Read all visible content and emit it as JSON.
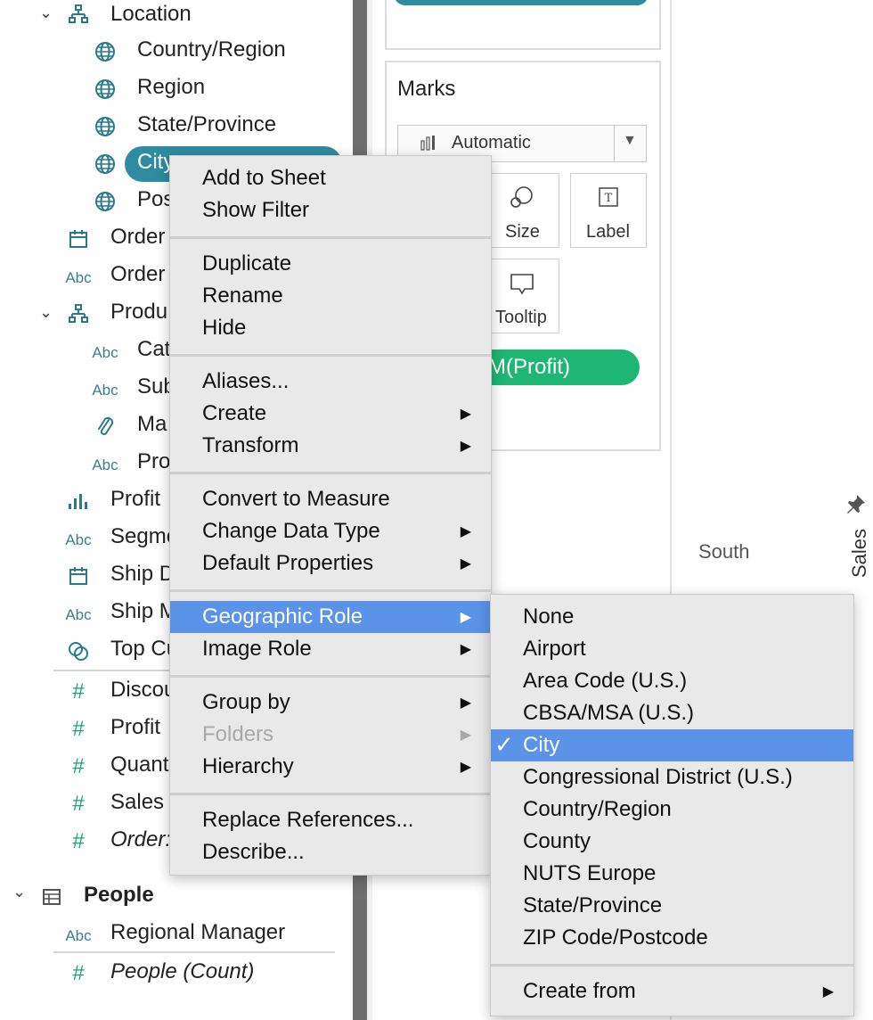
{
  "data_pane": {
    "location": {
      "label": "Location",
      "items": [
        {
          "label": "Country/Region",
          "icon": "globe-icon"
        },
        {
          "label": "Region",
          "icon": "globe-icon"
        },
        {
          "label": "State/Province",
          "icon": "globe-icon"
        },
        {
          "label": "City",
          "icon": "globe-icon"
        },
        {
          "label": "Pos",
          "icon": "globe-icon"
        }
      ]
    },
    "fields_a": [
      {
        "label": "Order",
        "icon": "calendar-icon"
      },
      {
        "label": "Order",
        "icon": "abc-icon",
        "glyph": "Abc"
      }
    ],
    "product": {
      "label": "Produ",
      "items": [
        {
          "label": "Cat",
          "glyph": "Abc"
        },
        {
          "label": "Sub",
          "glyph": "Abc"
        },
        {
          "label": "Ma",
          "glyph": "paperclip"
        },
        {
          "label": "Pro",
          "glyph": "Abc"
        }
      ]
    },
    "fields_b": [
      {
        "label": "Profit",
        "glyph": "bars"
      },
      {
        "label": "Segme",
        "glyph": "Abc"
      },
      {
        "label": "Ship D",
        "glyph": "calendar"
      },
      {
        "label": "Ship M",
        "glyph": "Abc"
      },
      {
        "label": "Top Cu",
        "glyph": "set"
      }
    ],
    "measures": [
      {
        "label": "Discou",
        "glyph": "#",
        "italic": false
      },
      {
        "label": "Profit",
        "glyph": "#",
        "italic": false
      },
      {
        "label": "Quant",
        "glyph": "#",
        "italic": false
      },
      {
        "label": "Sales",
        "glyph": "#",
        "italic": false
      },
      {
        "label": "Order:",
        "glyph": "#",
        "italic": true
      }
    ],
    "people": {
      "label": "People",
      "items": [
        {
          "label": "Regional Manager",
          "glyph": "Abc",
          "italic": false
        },
        {
          "label": "People (Count)",
          "glyph": "#",
          "italic": true
        }
      ]
    }
  },
  "marks": {
    "title": "Marks",
    "type_select": "Automatic",
    "size_label": "Size",
    "label_label": "Label",
    "tooltip_label": "Tooltip",
    "pill": "M(Profit)"
  },
  "view": {
    "axis_label": "South",
    "sales_label": "Sales"
  },
  "context_menu": [
    {
      "group": [
        "Add to Sheet",
        "Show Filter"
      ]
    },
    {
      "group": [
        "Duplicate",
        "Rename",
        "Hide"
      ]
    },
    {
      "group": [
        "Aliases...",
        "Create",
        "Transform"
      ]
    },
    {
      "group": [
        "Convert to Measure",
        "Change Data Type",
        "Default Properties"
      ]
    },
    {
      "group": [
        "Geographic Role",
        "Image Role"
      ]
    },
    {
      "group": [
        "Group by",
        "Folders",
        "Hierarchy"
      ]
    },
    {
      "group": [
        "Replace References...",
        "Describe..."
      ]
    }
  ],
  "submenu": {
    "items": [
      "None",
      "Airport",
      "Area Code (U.S.)",
      "CBSA/MSA (U.S.)",
      "City",
      "Congressional District (U.S.)",
      "Country/Region",
      "County",
      "NUTS Europe",
      "State/Province",
      "ZIP Code/Postcode"
    ],
    "checked": "City",
    "create_from": "Create from"
  },
  "colors": {
    "accent": "#2f8ba0",
    "highlight": "#5b93e9",
    "pill_green": "#1db673"
  }
}
